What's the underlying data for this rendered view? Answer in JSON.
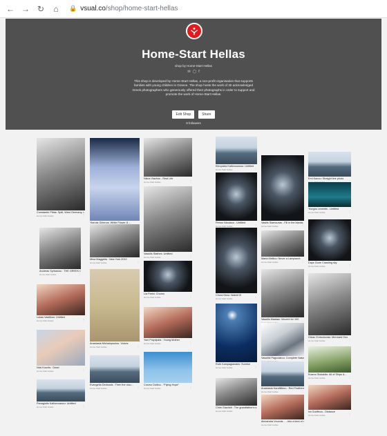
{
  "browser": {
    "back_icon": "arrow-left-icon",
    "forward_icon": "arrow-right-icon",
    "url_host": "vsual.co",
    "url_path": "/shop/home-start-hellas"
  },
  "hero": {
    "title": "Home-Start Hellas",
    "subtitle": "shop by Home-Start Hellas",
    "description": "This shop is developed by Home-Start Hellas, a non-profit organisation that supports families with young children in Greece. The shop hosts the work of 30 acknowledged Greek photographers who generously offered their photographs in order to support and promote the work of Home-Start Hellas.",
    "edit_label": "Edit Shop",
    "share_label": "Share",
    "followers": "9 followers",
    "logo_color": "#e3191e"
  },
  "photos": [
    {
      "caption": "Constantin Pittas: Split, West Germany, i...",
      "byline": "Home-Start Hellas",
      "tone": "bw"
    },
    {
      "caption": "Yiannis Girlenos: White Flower 8 ...",
      "byline": "Home-Start Hellas",
      "tone": "blue"
    },
    {
      "caption": "Nikos Vlachos - Real Life",
      "byline": "Home-Start Hellas",
      "tone": "bw"
    },
    {
      "caption": "Kleopatra Kallioroussou: Untitled",
      "byline": "Home-Start Hellas",
      "tone": "sea"
    },
    {
      "caption": "Vasilis Siamouras - Fill in the blanks",
      "byline": "Home-Start Hellas",
      "tone": "dark"
    },
    {
      "caption": "Emi Kanou: Straight line photo",
      "byline": "Home-Start Hellas",
      "tone": "sea"
    },
    {
      "caption": "Andreas Syrbasiou : THE GREEK COUN...",
      "byline": "Home-Start Hellas",
      "tone": "bw"
    },
    {
      "caption": "Mina Maggetla : New York 2010",
      "byline": "Home-Start Hellas",
      "tone": "bw"
    },
    {
      "caption": "Vassilis Stathes: Untitled",
      "byline": "Home-Start Hellas",
      "tone": "bw"
    },
    {
      "caption": "Petros Nicolaou - Untitled",
      "byline": "Home-Start Hellas",
      "tone": "dark"
    },
    {
      "caption": "Maria Melliou: Never a Lampwork",
      "byline": "Home-Start Hellas",
      "tone": "bw"
    },
    {
      "caption": "Yiorgos Leventis - Untitled",
      "byline": "Home-Start Hellas",
      "tone": "teal"
    },
    {
      "caption": "Lukas Vasilikos: Untitled",
      "byline": "Home-Start Hellas",
      "tone": "warm"
    },
    {
      "caption": "Anastasia Michalopoulou: Voices",
      "byline": "Home-Start Hellas",
      "tone": "sepia"
    },
    {
      "caption": "Lia Parisi: Chorus",
      "byline": "Home-Start Hellas",
      "tone": "dark"
    },
    {
      "caption": "Chora Nisiu: Naked III",
      "byline": "Home-Start Hellas",
      "tone": "dark"
    },
    {
      "caption": "Vassilis Maalaw: Vincent for 100",
      "byline": "Home-Start Hellas",
      "tone": "bw"
    },
    {
      "caption": "Days Gone Crawling sky",
      "byline": "Home-Start Hellas",
      "tone": "dark"
    },
    {
      "caption": "Nick Kourtis : Dead",
      "byline": "Home-Start Hellas",
      "tone": "pastel"
    },
    {
      "caption": "Yoni Polydjukis : Young Mother",
      "byline": "Home-Start Hellas",
      "tone": "warm"
    },
    {
      "caption": "Ruth Kampagianakis: Sunrise",
      "byline": "Home-Start Hellas",
      "tone": "night"
    },
    {
      "caption": "Vassiliki Pagoulatou: Complete Nature",
      "byline": "Home-Start Hellas",
      "tone": "snow"
    },
    {
      "caption": "Gikas Chrisolouras: Mermaid Ono",
      "byline": "Home-Start Hellas",
      "tone": "bw"
    },
    {
      "caption": "Evangelia Dedousis : Then the clou...",
      "byline": "Home-Start Hellas",
      "tone": "sea"
    },
    {
      "caption": "Cosmo Dolliou - \"Flying Hope\"",
      "byline": "Home-Start Hellas",
      "tone": "sky"
    },
    {
      "caption": "Anastasia Karafillidou : Red Feathers",
      "byline": "Home-Start Hellas",
      "tone": "sea"
    },
    {
      "caption": "Kosmo Siokaidis: All of Ships &...",
      "byline": "Home-Start Hellas",
      "tone": "green"
    },
    {
      "caption": "Panagiotis Kallioroussou: Untitled",
      "byline": "Home-Start Hellas",
      "tone": "sea"
    },
    {
      "caption": "Chris Giachidi : The grandfather's s...",
      "byline": "Home-Start Hellas",
      "tone": "bw"
    },
    {
      "caption": "Alexandra Vouvois - ...Into a kind of rai...",
      "byline": "Home-Start Hellas",
      "tone": "warm"
    },
    {
      "caption": "Ira Godfinou - Distance",
      "byline": "Home-Start Hellas",
      "tone": "warm"
    }
  ],
  "colors": {
    "hero_bg": "#505050",
    "page_bg": "#f2f2f2",
    "accent": "#e3191e"
  }
}
